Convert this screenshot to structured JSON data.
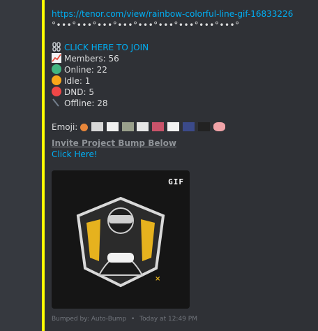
{
  "embed": {
    "accent_color": "#ffff00",
    "tenor_link": "https://tenor.com/view/rainbow-colorful-line-gif-16833226",
    "decor_line": "°•••°•••°•••°•••°•••°•••°•••°•••°•••°",
    "join": {
      "icon": "link-icon",
      "label": "CLICK HERE TO JOIN"
    },
    "stats": [
      {
        "icon": "chart-icon",
        "label": "Members: 56",
        "color": "#e74c3c"
      },
      {
        "icon": "online-dot-icon",
        "label": "Online: 22",
        "color": "#43b581"
      },
      {
        "icon": "idle-dot-icon",
        "label": "Idle: 1",
        "color": "#faa61a"
      },
      {
        "icon": "dnd-dot-icon",
        "label": "DND: 5",
        "color": "#f04747"
      },
      {
        "icon": "offline-icon",
        "label": "Offline: 28",
        "color": "#747f8d"
      }
    ],
    "emoji_label": "Emoji:",
    "invite_label": "Invite Project Bump Below",
    "click_here": "Click Here!",
    "gif_badge": "GIF",
    "footer": {
      "author": "Bumped by: Auto-Bump",
      "separator": "•",
      "timestamp": "Today at 12:49 PM"
    }
  }
}
